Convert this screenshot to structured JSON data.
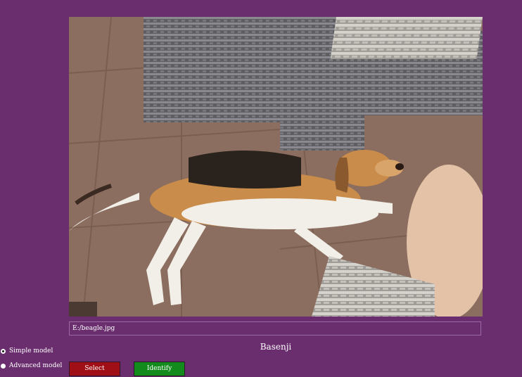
{
  "image": {
    "alt": "Beagle puppy lying on a tiled floor next to a wicker chair"
  },
  "path_field": {
    "value": "E:/beagle.jpg"
  },
  "result": {
    "label": "Basenji"
  },
  "model_options": [
    {
      "label": "Simple model",
      "selected": true
    },
    {
      "label": "Advanced model",
      "selected": false
    }
  ],
  "buttons": {
    "select_label": "Select",
    "identify_label": "Identify"
  },
  "colors": {
    "background": "#6a2e6e",
    "select_button": "#a00f16",
    "identify_button": "#138a1c"
  }
}
